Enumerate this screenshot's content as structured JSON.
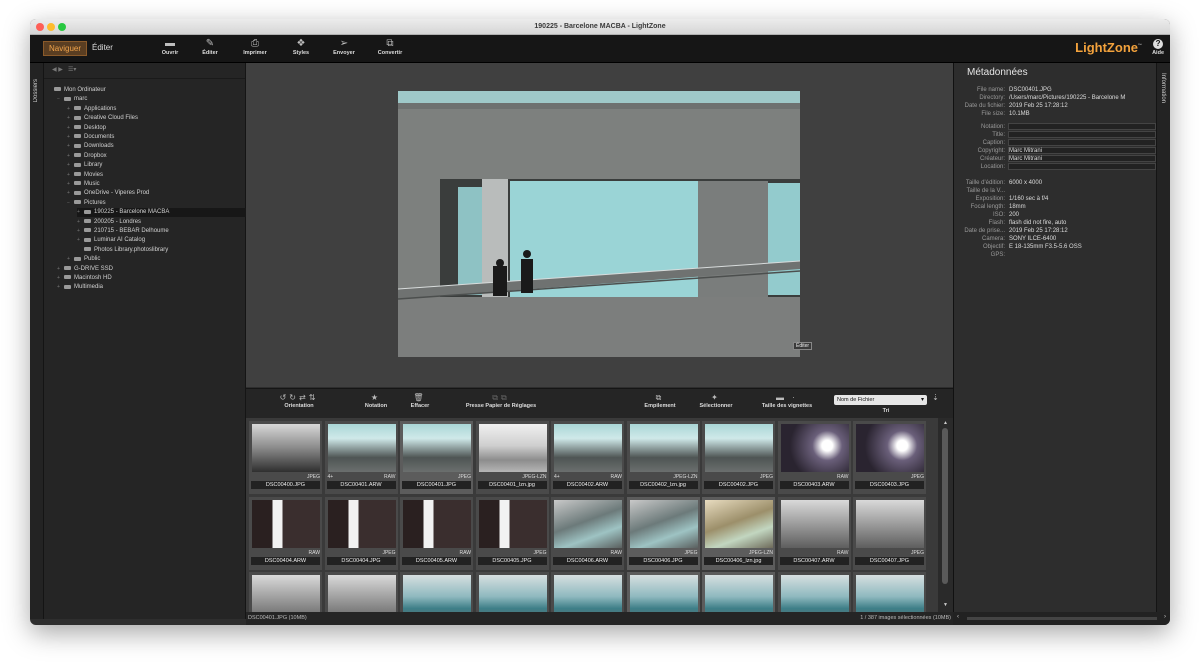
{
  "window": {
    "title": "190225 - Barcelone MACBA - LightZone"
  },
  "mode_tabs": [
    {
      "label": "Naviguer"
    },
    {
      "label": "Éditer"
    }
  ],
  "toolbar": {
    "buttons": [
      {
        "label": "Ouvrir",
        "icon": "open-folder-icon"
      },
      {
        "label": "Éditer",
        "icon": "edit-icon"
      },
      {
        "label": "Imprimer",
        "icon": "printer-icon"
      },
      {
        "label": "Styles",
        "icon": "styles-icon"
      },
      {
        "label": "Envoyer",
        "icon": "send-icon"
      },
      {
        "label": "Convertir",
        "icon": "convert-icon"
      }
    ],
    "brand": "LightZone",
    "brand_tm": "™",
    "help_label": "Aide",
    "help_icon_glyph": "?"
  },
  "left_tab": {
    "label": "Dossiers"
  },
  "right_tab": {
    "label": "Information"
  },
  "tree": {
    "items": [
      {
        "label": "Mon Ordinateur",
        "level": 0,
        "expander": ""
      },
      {
        "label": "marc",
        "level": 1,
        "expander": "−"
      },
      {
        "label": "Applications",
        "level": 2,
        "expander": "+"
      },
      {
        "label": "Creative Cloud Files",
        "level": 2,
        "expander": "+"
      },
      {
        "label": "Desktop",
        "level": 2,
        "expander": "+"
      },
      {
        "label": "Documents",
        "level": 2,
        "expander": "+"
      },
      {
        "label": "Downloads",
        "level": 2,
        "expander": "+"
      },
      {
        "label": "Dropbox",
        "level": 2,
        "expander": "+"
      },
      {
        "label": "Library",
        "level": 2,
        "expander": "+"
      },
      {
        "label": "Movies",
        "level": 2,
        "expander": "+"
      },
      {
        "label": "Music",
        "level": 2,
        "expander": "+"
      },
      {
        "label": "OneDrive - Viperes Prod",
        "level": 2,
        "expander": "+"
      },
      {
        "label": "Pictures",
        "level": 2,
        "expander": "−"
      },
      {
        "label": "190225 - Barcelone MACBA",
        "level": 3,
        "expander": "+",
        "selected": true
      },
      {
        "label": "200205 - Londres",
        "level": 3,
        "expander": "+"
      },
      {
        "label": "210715 - BEBAR Delhoume",
        "level": 3,
        "expander": "+"
      },
      {
        "label": "Luminar AI Catalog",
        "level": 3,
        "expander": "+"
      },
      {
        "label": "Photos Library.photoslibrary",
        "level": 3,
        "expander": ""
      },
      {
        "label": "Public",
        "level": 2,
        "expander": "+"
      },
      {
        "label": "G-DRIVE SSD",
        "level": 1,
        "expander": "+"
      },
      {
        "label": "Macintosh HD",
        "level": 1,
        "expander": "+"
      },
      {
        "label": "Multimedia",
        "level": 1,
        "expander": "+"
      }
    ]
  },
  "viewer": {
    "edit_badge": "Éditer"
  },
  "tools": {
    "orientation": "Orientation",
    "rating": "Notation",
    "delete": "Effacer",
    "clipboard": "Presse Papier de Réglages",
    "stack": "Empilement",
    "select": "Sélectionner",
    "thumb_size": "Taille des vignettes",
    "sort": "Tri",
    "sort_value": "Nom de Fichier"
  },
  "thumbnails": [
    {
      "name": "DSC00400.JPG",
      "tag": "JPEG",
      "count": "",
      "kind": "interior"
    },
    {
      "name": "DSC00401.ARW",
      "tag": "RAW",
      "count": "4+",
      "kind": "teal"
    },
    {
      "name": "DSC00401.JPG",
      "tag": "JPEG",
      "count": "",
      "kind": "teal",
      "highlight": true
    },
    {
      "name": "DSC00401_lzn.jpg",
      "tag": "JPEG-LZN",
      "count": "",
      "kind": "bw"
    },
    {
      "name": "DSC00402.ARW",
      "tag": "RAW",
      "count": "4+",
      "kind": "teal"
    },
    {
      "name": "DSC00402_lzn.jpg",
      "tag": "JPEG-LZN",
      "count": "",
      "kind": "teal"
    },
    {
      "name": "DSC00402.JPG",
      "tag": "JPEG",
      "count": "",
      "kind": "teal"
    },
    {
      "name": "DSC00403.ARW",
      "tag": "RAW",
      "count": "",
      "kind": "window"
    },
    {
      "name": "DSC00403.JPG",
      "tag": "JPEG",
      "count": "",
      "kind": "window"
    },
    {
      "name": "DSC00404.ARW",
      "tag": "RAW",
      "count": "",
      "kind": "door"
    },
    {
      "name": "DSC00404.JPG",
      "tag": "JPEG",
      "count": "",
      "kind": "door"
    },
    {
      "name": "DSC00405.ARW",
      "tag": "RAW",
      "count": "",
      "kind": "door"
    },
    {
      "name": "DSC00405.JPG",
      "tag": "JPEG",
      "count": "",
      "kind": "door"
    },
    {
      "name": "DSC00406.ARW",
      "tag": "RAW",
      "count": "",
      "kind": "corridor"
    },
    {
      "name": "DSC00406.JPG",
      "tag": "JPEG",
      "count": "",
      "kind": "corridor",
      "highlight": true
    },
    {
      "name": "DSC00406_lzn.jpg",
      "tag": "JPEG-LZN",
      "count": "",
      "kind": "warm",
      "highlight": true
    },
    {
      "name": "DSC00407.ARW",
      "tag": "RAW",
      "count": "",
      "kind": "roof"
    },
    {
      "name": "DSC00407.JPG",
      "tag": "JPEG",
      "count": "",
      "kind": "roof"
    },
    {
      "name": "",
      "tag": "",
      "count": "",
      "kind": "roof"
    },
    {
      "name": "",
      "tag": "",
      "count": "",
      "kind": "roof"
    },
    {
      "name": "",
      "tag": "",
      "count": "",
      "kind": "sea"
    },
    {
      "name": "",
      "tag": "",
      "count": "",
      "kind": "sea"
    },
    {
      "name": "",
      "tag": "",
      "count": "",
      "kind": "sea"
    },
    {
      "name": "",
      "tag": "",
      "count": "",
      "kind": "sea",
      "highlight": true
    },
    {
      "name": "",
      "tag": "",
      "count": "",
      "kind": "sea",
      "highlight": true
    },
    {
      "name": "",
      "tag": "",
      "count": "",
      "kind": "sea"
    },
    {
      "name": "",
      "tag": "",
      "count": "",
      "kind": "sea"
    }
  ],
  "status": {
    "left": "DSC00401.JPG (10MB)",
    "right": "1 / 387 images sélectionnées (10MB)"
  },
  "metadata": {
    "title": "Métadonnées",
    "fields": [
      {
        "key": "File name:",
        "value": "DSC00401.JPG"
      },
      {
        "key": "Directory:",
        "value": "/Users/marc/Pictures/190225 - Barcelone M"
      },
      {
        "key": "Date du fichier:",
        "value": "2019 Feb 25 17:28:12"
      },
      {
        "key": "File size:",
        "value": "10.1MB"
      },
      {
        "key": "Notation:",
        "value": "",
        "box": true
      },
      {
        "key": "Title:",
        "value": "",
        "box": true
      },
      {
        "key": "Caption:",
        "value": "",
        "box": true
      },
      {
        "key": "Copyright:",
        "value": "Marc Mitrani",
        "box": true
      },
      {
        "key": "Créateur:",
        "value": "Marc Mitrani",
        "box": true
      },
      {
        "key": "Location:",
        "value": "",
        "box": true
      },
      {
        "key": "Taille d'édition:",
        "value": "6000 x 4000"
      },
      {
        "key": "Taille de la V...",
        "value": ""
      },
      {
        "key": "Exposition:",
        "value": "1/160 sec à f/4"
      },
      {
        "key": "Focal length:",
        "value": "18mm"
      },
      {
        "key": "ISO:",
        "value": "200"
      },
      {
        "key": "Flash:",
        "value": "flash did not fire, auto"
      },
      {
        "key": "Date de prise...",
        "value": "2019 Feb 25 17:28:12"
      },
      {
        "key": "Camera:",
        "value": "SONY ILCE-6400"
      },
      {
        "key": "Objectif:",
        "value": "E 18-135mm F3.5-5.6 OSS"
      },
      {
        "key": "GPS:",
        "value": ""
      }
    ]
  }
}
